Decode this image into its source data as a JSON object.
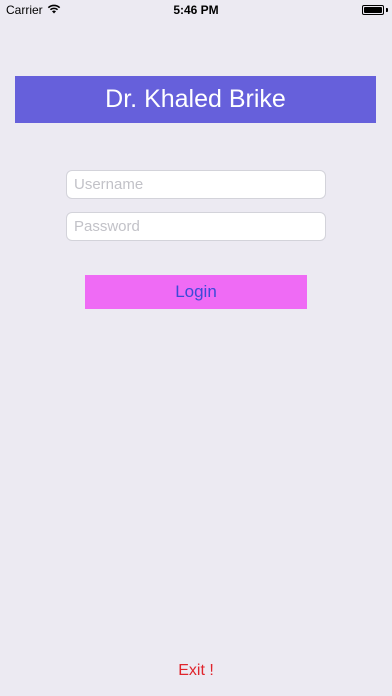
{
  "status_bar": {
    "carrier": "Carrier",
    "time": "5:46 PM",
    "wifi_icon": "wifi-icon",
    "battery_icon": "battery-icon"
  },
  "title": "Dr. Khaled Brike",
  "login_form": {
    "username_placeholder": "Username",
    "username_value": "",
    "password_placeholder": "Password",
    "password_value": "",
    "login_label": "Login"
  },
  "exit_label": "Exit !",
  "colors": {
    "background": "#eceaf2",
    "title_banner": "#6660db",
    "login_button": "#ef6bf5",
    "login_text": "#3b4bd8",
    "exit_text": "#e0242c"
  }
}
